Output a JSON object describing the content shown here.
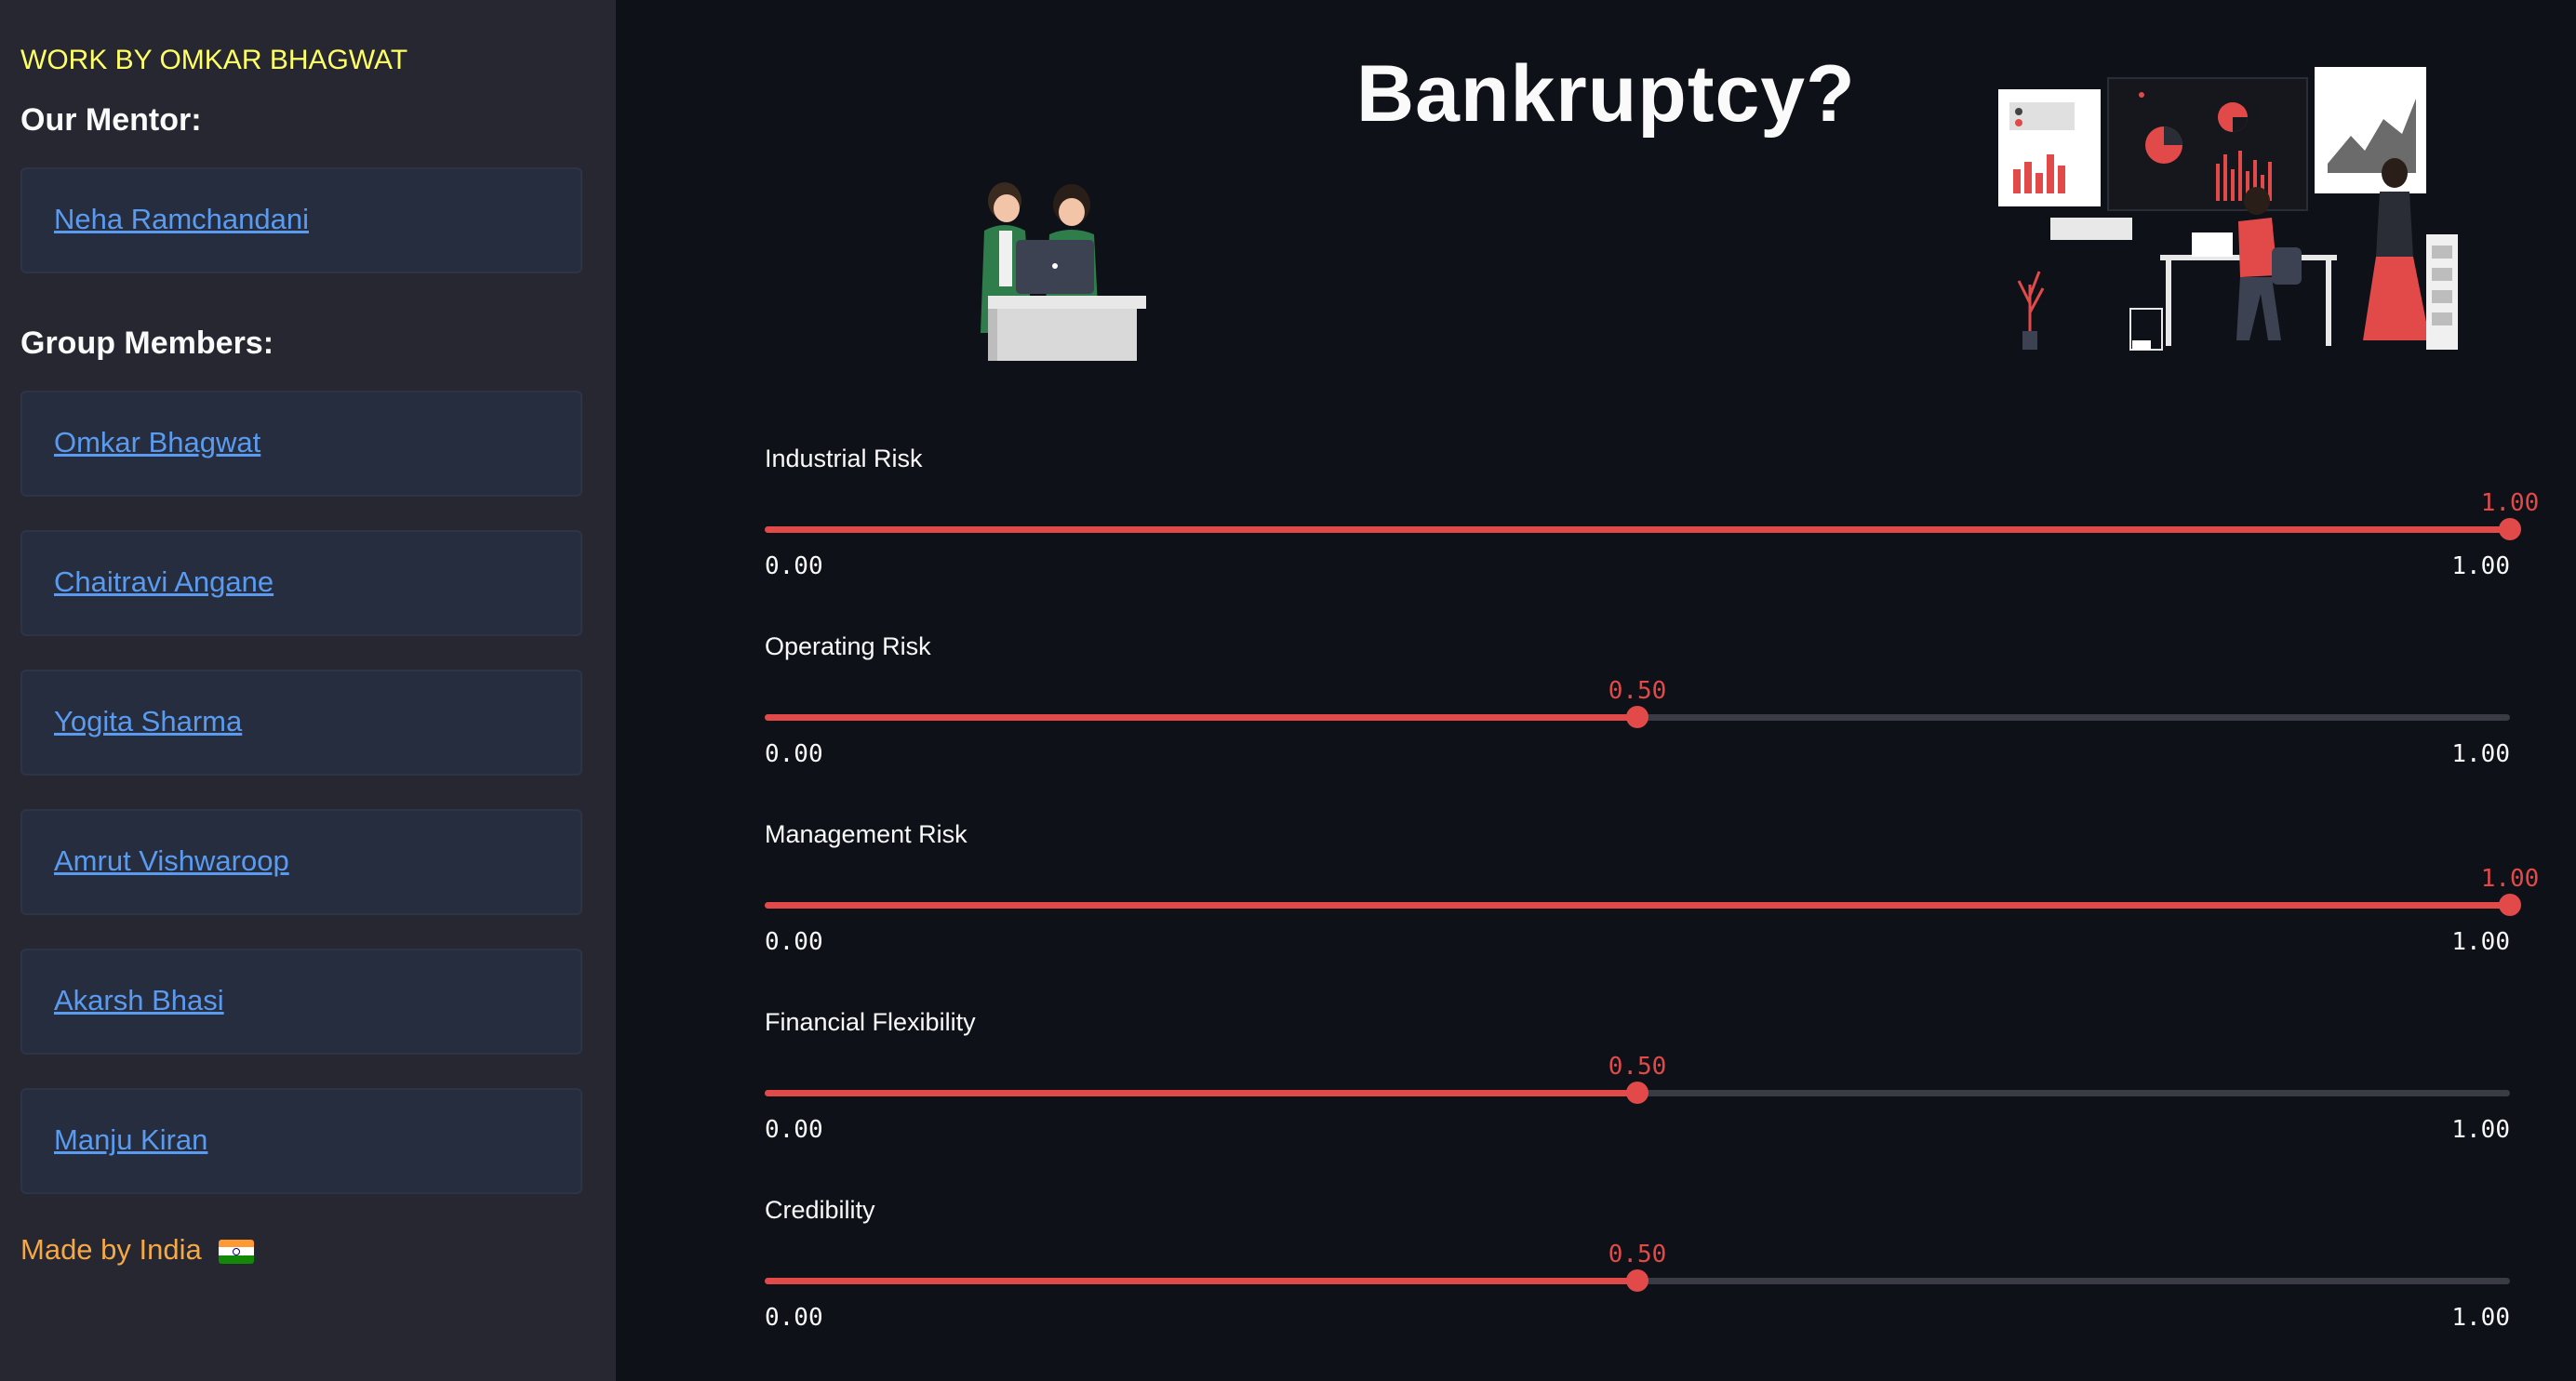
{
  "sidebar": {
    "work_by": "WORK BY OMKAR BHAGWAT",
    "mentor_title": "Our Mentor:",
    "mentor": "Neha Ramchandani",
    "group_title": "Group Members:",
    "members": [
      "Omkar Bhagwat",
      "Chaitravi Angane",
      "Yogita Sharma",
      "Amrut Vishwaroop",
      "Akarsh Bhasi",
      "Manju Kiran"
    ],
    "made_by": "Made by India"
  },
  "main": {
    "title": "Bankruptcy?",
    "sliders": [
      {
        "label": "Industrial Risk",
        "value": "1.00",
        "fraction": 1.0,
        "min": "0.00",
        "max": "1.00"
      },
      {
        "label": "Operating Risk",
        "value": "0.50",
        "fraction": 0.5,
        "min": "0.00",
        "max": "1.00"
      },
      {
        "label": "Management Risk",
        "value": "1.00",
        "fraction": 1.0,
        "min": "0.00",
        "max": "1.00"
      },
      {
        "label": "Financial Flexibility",
        "value": "0.50",
        "fraction": 0.5,
        "min": "0.00",
        "max": "1.00"
      },
      {
        "label": "Credibility",
        "value": "0.50",
        "fraction": 0.5,
        "min": "0.00",
        "max": "1.00"
      }
    ]
  },
  "colors": {
    "accent": "#e24a4a",
    "link": "#5a9bf0",
    "work_by": "#ffff66",
    "made_by": "#f5a847"
  }
}
